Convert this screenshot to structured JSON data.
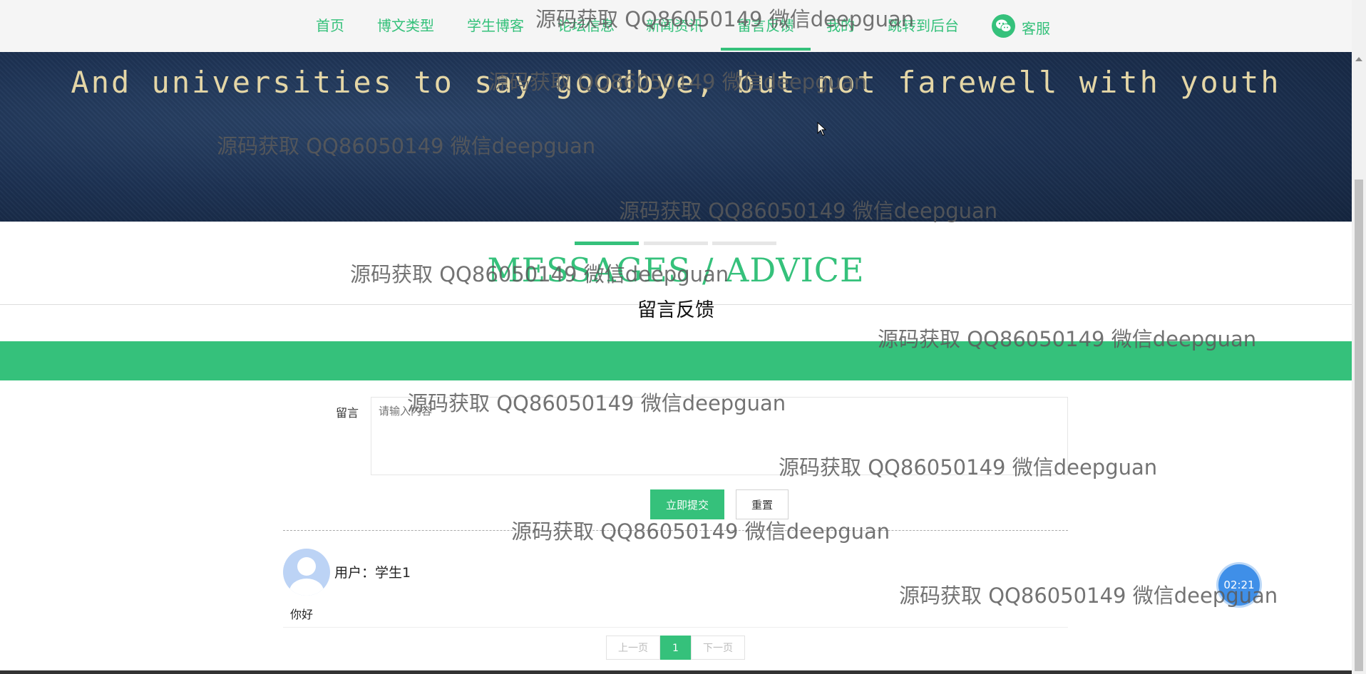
{
  "nav": {
    "items": [
      "首页",
      "博文类型",
      "学生博客",
      "论坛信息",
      "新闻资讯",
      "留言反馈",
      "我的",
      "跳转到后台"
    ],
    "active": "留言反馈",
    "service_label": "客服",
    "service_icon": "wechat-icon"
  },
  "banner": {
    "text": "And universities to say goodbye, but not farewell with youth"
  },
  "section": {
    "title": "MESSAGES / ADVICE",
    "subtitle": "留言反馈"
  },
  "form": {
    "label": "留言",
    "placeholder": "请输入内容",
    "submit_label": "立即提交",
    "reset_label": "重置"
  },
  "comments": [
    {
      "user": "用户：学生1",
      "content": "你好"
    }
  ],
  "pagination": {
    "prev": "上一页",
    "current": "1",
    "next": "下一页"
  },
  "timer": "02:21",
  "watermark": "源码获取 QQ86050149 微信deepguan",
  "colors": {
    "accent": "#35c17b",
    "banner": "#1d3253",
    "timer": "#3f8fe8"
  }
}
